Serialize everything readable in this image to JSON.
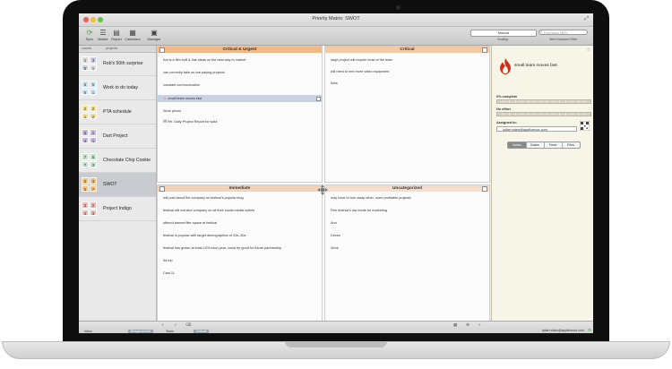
{
  "app": {
    "window_title": "Priority Matrix: SWOT"
  },
  "toolbar": {
    "items": [
      {
        "label": "Sync",
        "icon": "sync-icon"
      },
      {
        "label": "Master",
        "icon": "list-icon"
      },
      {
        "label": "Report",
        "icon": "report-icon"
      },
      {
        "label": "Calendars",
        "icon": "calendar-icon"
      },
      {
        "label": "Manager",
        "icon": "briefcase-icon"
      }
    ],
    "sort_value": "Manual",
    "sort_label": "Sorting",
    "search_placeholder": "Find Items (⌘F)",
    "search_label": "Item Keyword Filter"
  },
  "sidebar": {
    "col_counts": "counts",
    "col_projects": "projects",
    "projects": [
      {
        "name": "Rob's 50th surprise",
        "counts": [
          "1",
          "3",
          "5",
          "1"
        ],
        "colors": [
          "#d9d9d9",
          "#c8cbe6",
          "#c8cbe6",
          "#d9d9d9"
        ]
      },
      {
        "name": "Work to do today",
        "counts": [
          "5",
          "5",
          "5",
          "1"
        ],
        "colors": [
          "#c7e3f1",
          "#c7e3f1",
          "#c7e3f1",
          "#c7e3f1"
        ]
      },
      {
        "name": "PTA schedule",
        "counts": [
          "2",
          "2",
          "1",
          "2"
        ],
        "colors": [
          "#f5dd8b",
          "#f5dd8b",
          "#f5dd8b",
          "#f5dd8b"
        ]
      },
      {
        "name": "Dart Project",
        "counts": [
          "5",
          "1",
          "4",
          "1"
        ],
        "colors": [
          "#c6b6dc",
          "#c6b6dc",
          "#c6b6dc",
          "#c6b6dc"
        ]
      },
      {
        "name": "Chocolate Chip Cookie",
        "counts": [
          "7",
          "5",
          "7",
          "3"
        ],
        "colors": [
          "#bfe3c8",
          "#bfe3c8",
          "#bfe3c8",
          "#bfe3c8"
        ]
      },
      {
        "name": "SWOT",
        "counts": [
          "0",
          "3",
          "5",
          "7"
        ],
        "colors": [
          "#f6c07a",
          "#f6c07a",
          "#f6c07a",
          "#f6c07a"
        ]
      },
      {
        "name": "Project Indigo",
        "counts": [
          "3",
          "2",
          "4",
          "3"
        ],
        "colors": [
          "#f4b6b0",
          "#f4b6b0",
          "#f4b6b0",
          "#f4b6b0"
        ]
      }
    ],
    "bottom_icons": [
      "add-icon",
      "help-icon",
      "filter-icon"
    ]
  },
  "matrix": {
    "quadrants": [
      {
        "title": "Critical & Urgent",
        "header_color": "#efb884",
        "items": [
          "Kat is a film buff & has ideas on the best way to market",
          "can currently take on low paying projects",
          "constant communication",
          "small team moves fast",
          "Work phone",
          "Re: Daily Project Report for lydia"
        ]
      },
      {
        "title": "Critical",
        "header_color": "#f3c9a3",
        "items": [
          "large project will require most of the team",
          "will need to rent more video equipment",
          "lines"
        ]
      },
      {
        "title": "Immediate",
        "header_color": "#f4d2b8",
        "items": [
          "will post about the company on festival's popular blog",
          "festival will mention company on all their social media outlets",
          "offered banner/flier space at festival",
          "festival is popular with target demographics of 20s–30s",
          "festival has grown at least 10% each year, could be good for future partnership",
          "5d trip",
          "Cast 11"
        ]
      },
      {
        "title": "Uncategorized",
        "header_color": "#f6dccb",
        "items": [
          "may have to turn away other, more profitable projects",
          "Film festival's low funds for marketing",
          "Ann",
          "Drives",
          "Work"
        ]
      }
    ],
    "bottom_icons": [
      "add-icon",
      "check-icon",
      "trash-icon"
    ],
    "bottom_right_icons": [
      "view-icon",
      "settings-icon",
      "next-icon"
    ]
  },
  "details": {
    "title": "small team moves fast",
    "pct_label": "0% complete",
    "effort_label": "No effort",
    "assigned_label": "Assigned to:",
    "assignee": "lydia+video@appfluence.com",
    "tabs": [
      "Notes",
      "Dates",
      "Feed",
      "Files"
    ]
  },
  "statusbar": {
    "items": [
      "Inbox",
      "Bhagaram list",
      "Team",
      "Default"
    ],
    "email": "lydia+video@appfluence.com"
  }
}
